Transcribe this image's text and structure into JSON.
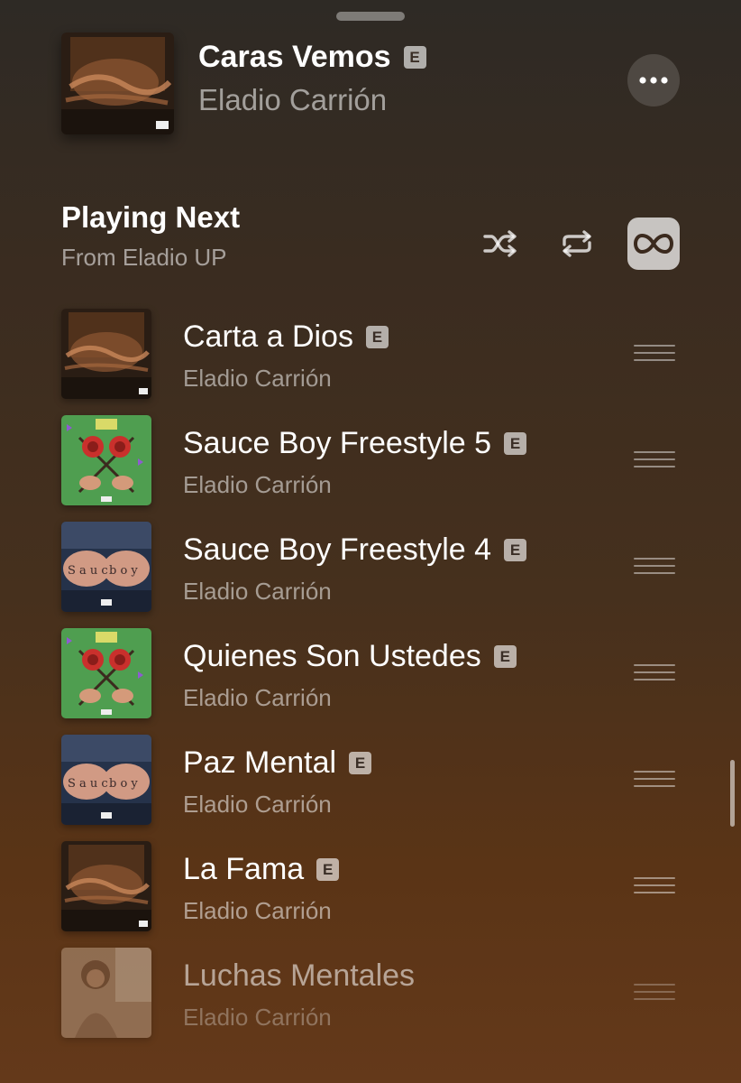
{
  "now_playing": {
    "title": "Caras Vemos",
    "explicit_label": "E",
    "artist": "Eladio Carrión",
    "more_icon": "ellipsis-icon"
  },
  "playing_next": {
    "heading": "Playing Next",
    "source": "From Eladio UP",
    "controls": [
      {
        "icon": "shuffle-icon",
        "active": false
      },
      {
        "icon": "repeat-icon",
        "active": false
      },
      {
        "icon": "infinity-autoplay-icon",
        "active": true
      }
    ]
  },
  "queue": [
    {
      "title": "Carta a Dios",
      "artist": "Eladio Carrión",
      "explicit": "E",
      "art": "sauce-boy-dark"
    },
    {
      "title": "Sauce Boy Freestyle 5",
      "artist": "Eladio Carrión",
      "explicit": "E",
      "art": "green-roses"
    },
    {
      "title": "Sauce Boy Freestyle 4",
      "artist": "Eladio Carrión",
      "explicit": "E",
      "art": "knuckle-tattoos"
    },
    {
      "title": "Quienes Son Ustedes",
      "artist": "Eladio Carrión",
      "explicit": "E",
      "art": "green-roses"
    },
    {
      "title": "Paz Mental",
      "artist": "Eladio Carrión",
      "explicit": "E",
      "art": "knuckle-tattoos"
    },
    {
      "title": "La Fama",
      "artist": "Eladio Carrión",
      "explicit": "E",
      "art": "sauce-boy-dark"
    },
    {
      "title": "Luchas Mentales",
      "artist": "Eladio Carrión",
      "explicit": "",
      "art": "portrait-sepia"
    }
  ],
  "colors": {
    "accent_active": "#c9c2bc",
    "background_top": "#2e2a25",
    "background_bottom": "#64391a"
  }
}
